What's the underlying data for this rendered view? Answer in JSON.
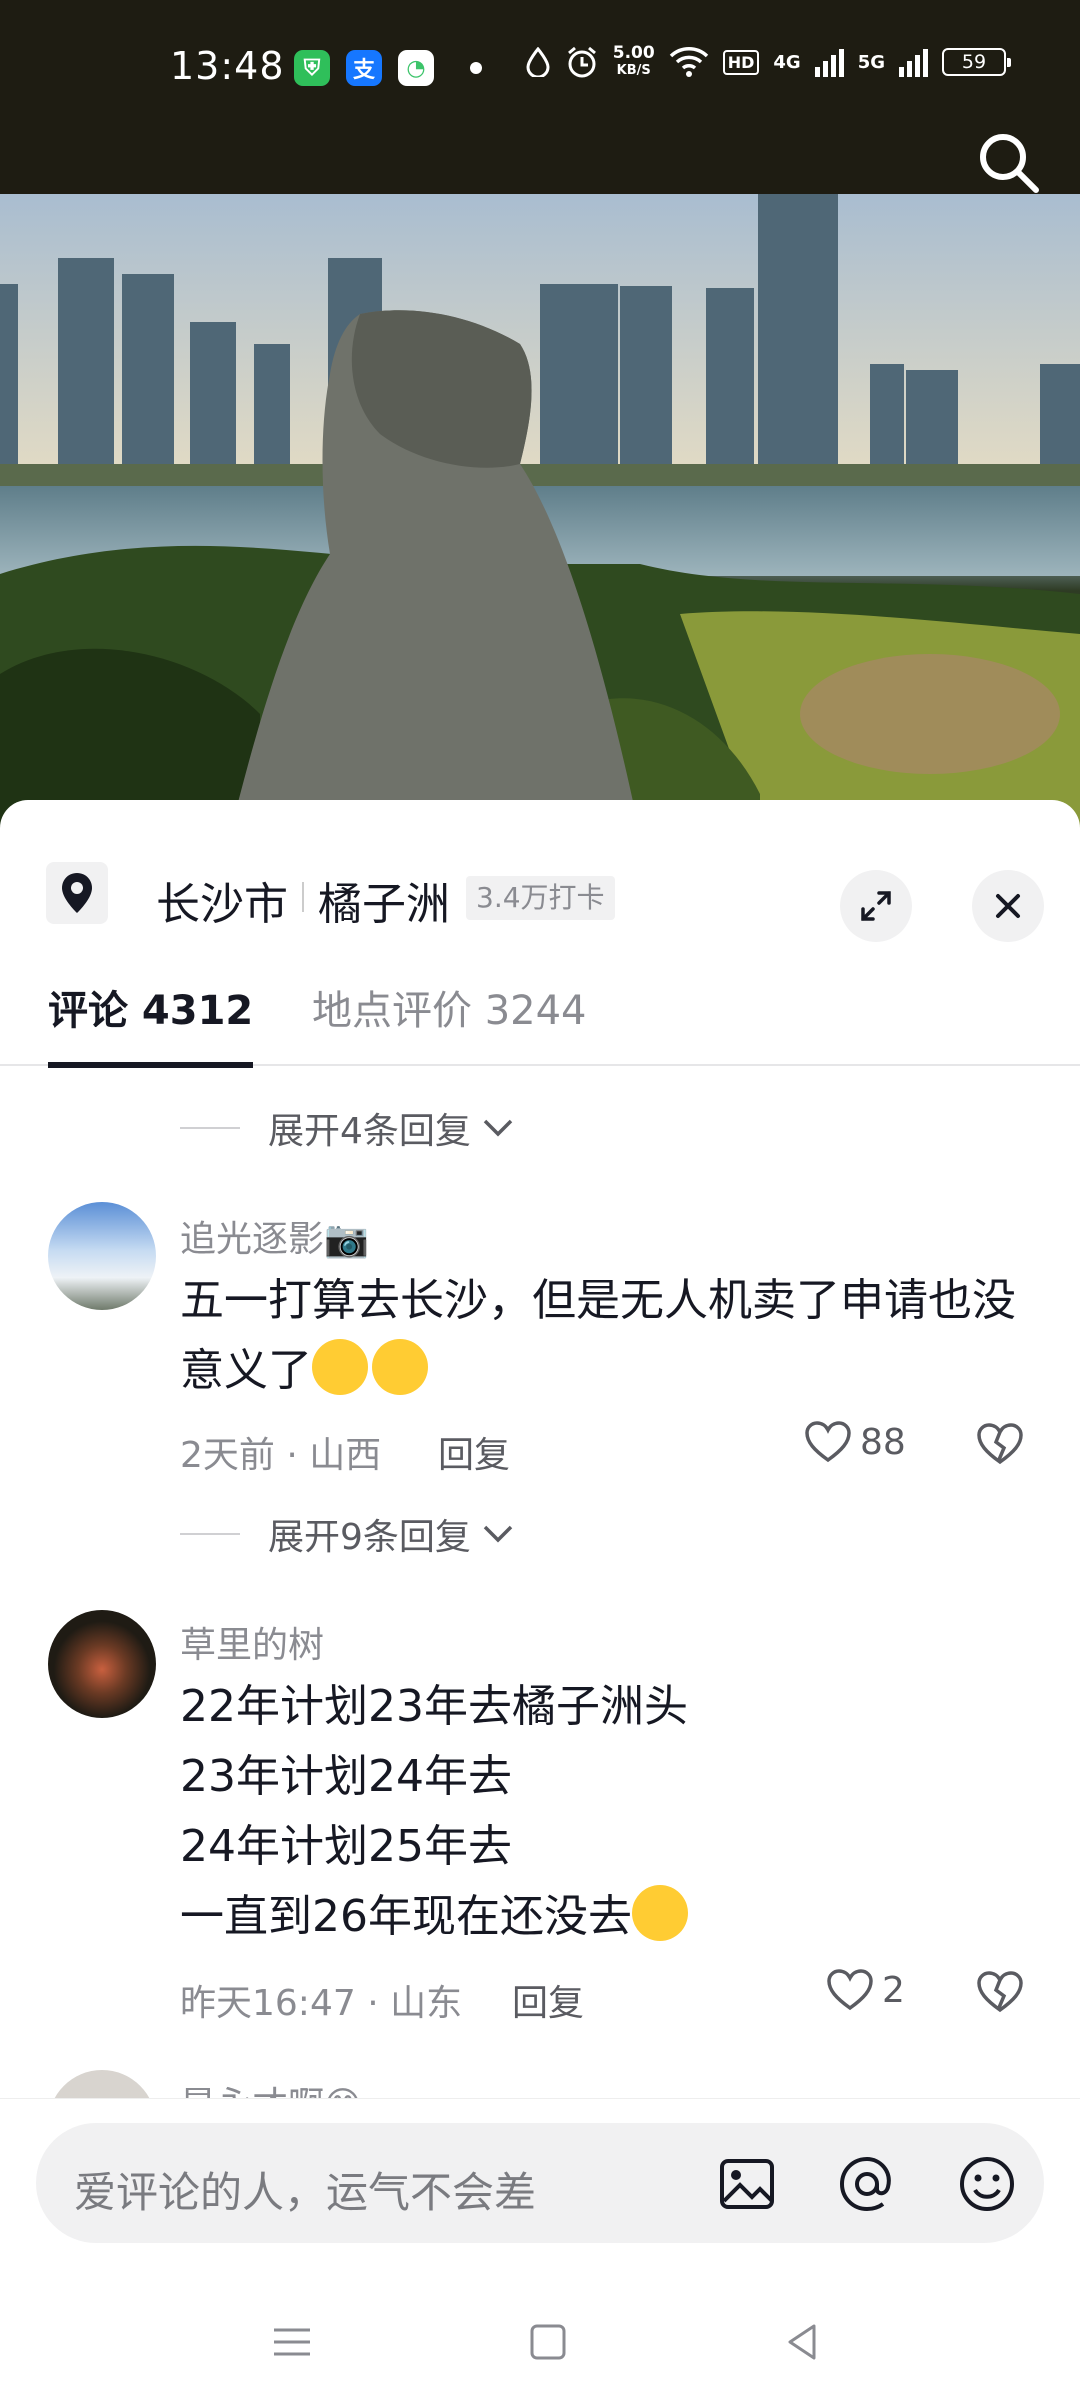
{
  "status_bar": {
    "time": "13:48",
    "apps": [
      {
        "icon": "shield-app-icon",
        "color": "#2fbf5a",
        "glyph": "⛨"
      },
      {
        "icon": "alipay-icon",
        "color": "#1677ff",
        "glyph": "支"
      },
      {
        "icon": "green-app-icon",
        "color": "#3cc46a",
        "glyph": "◔"
      }
    ],
    "net_speed_value": "5.00",
    "net_speed_unit": "KB/S",
    "hd_tag": "HD",
    "net1": "4G",
    "net2": "5G",
    "battery": "59"
  },
  "location": {
    "city": "长沙市",
    "place": "橘子洲",
    "checkins": "3.4万打卡"
  },
  "tabs": {
    "comments": "评论 4312",
    "reviews": "地点评价 3244"
  },
  "expand1": "展开4条回复",
  "expand2": "展开9条回复",
  "comments": [
    {
      "author": "追光逐影📷",
      "text": "五一打算去长沙，但是无人机卖了申请也没意义了",
      "emojis": [
        "😭",
        "😭"
      ],
      "time_place": "2天前 · 山西",
      "reply": "回复",
      "likes": "88"
    },
    {
      "author": "草里的树",
      "lines": [
        "22年计划23年去橘子洲头",
        "23年计划24年去",
        "24年计划25年去",
        "一直到26年现在还没去"
      ],
      "emoji": "🤣",
      "time_place": "昨天16:47 · 山东",
      "reply": "回复",
      "likes": "2"
    },
    {
      "author": "是永才啊😊"
    }
  ],
  "input": {
    "placeholder": "爱评论的人，运气不会差"
  },
  "colors": {
    "text": "#161823",
    "secondary": "#8a8b91",
    "status_bar_bg": "#1e1c12"
  }
}
